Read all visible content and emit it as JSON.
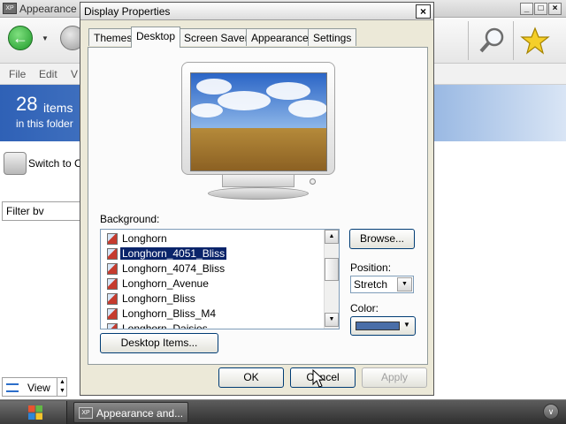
{
  "background_window": {
    "title": "Appearance",
    "app_icon_text": "XP",
    "controls": {
      "minimize": "_",
      "maximize": "□",
      "close": "×"
    },
    "menu": [
      "File",
      "Edit",
      "V"
    ],
    "header": {
      "count": "28",
      "items_text": "items",
      "subtitle": "in this folder"
    },
    "switch_label": "Switch to C",
    "filter_value": "Filter bv",
    "view_label": "View",
    "toolbar_icons": [
      "back-icon",
      "forward-icon",
      "search-icon",
      "favorites-icon"
    ]
  },
  "dialog": {
    "title": "Display Properties",
    "close_glyph": "×",
    "tabs": [
      "Themes",
      "Desktop",
      "Screen Saver",
      "Appearance",
      "Settings"
    ],
    "active_tab": "Desktop",
    "background_label": "Background:",
    "background_items": [
      "Longhorn",
      "Longhorn_4051_Bliss",
      "Longhorn_4074_Bliss",
      "Longhorn_Avenue",
      "Longhorn_Bliss",
      "Longhorn_Bliss_M4",
      "Longhorn_Daisies"
    ],
    "selected_item": "Longhorn_4051_Bliss",
    "browse_button": "Browse...",
    "position_label": "Position:",
    "position_value": "Stretch",
    "color_label": "Color:",
    "color_value": "#4a6ea8",
    "desktop_items_button": "Desktop Items...",
    "ok_button": "OK",
    "cancel_button": "Cancel",
    "apply_button": "Apply"
  },
  "taskbar": {
    "task_label": "Appearance and...",
    "task_icon_text": "XP"
  },
  "colors": {
    "header_blue": "#2f61b6",
    "dialog_face": "#ece9d8",
    "selection": "#0a246a",
    "taskbar": "#3b3b3b"
  }
}
